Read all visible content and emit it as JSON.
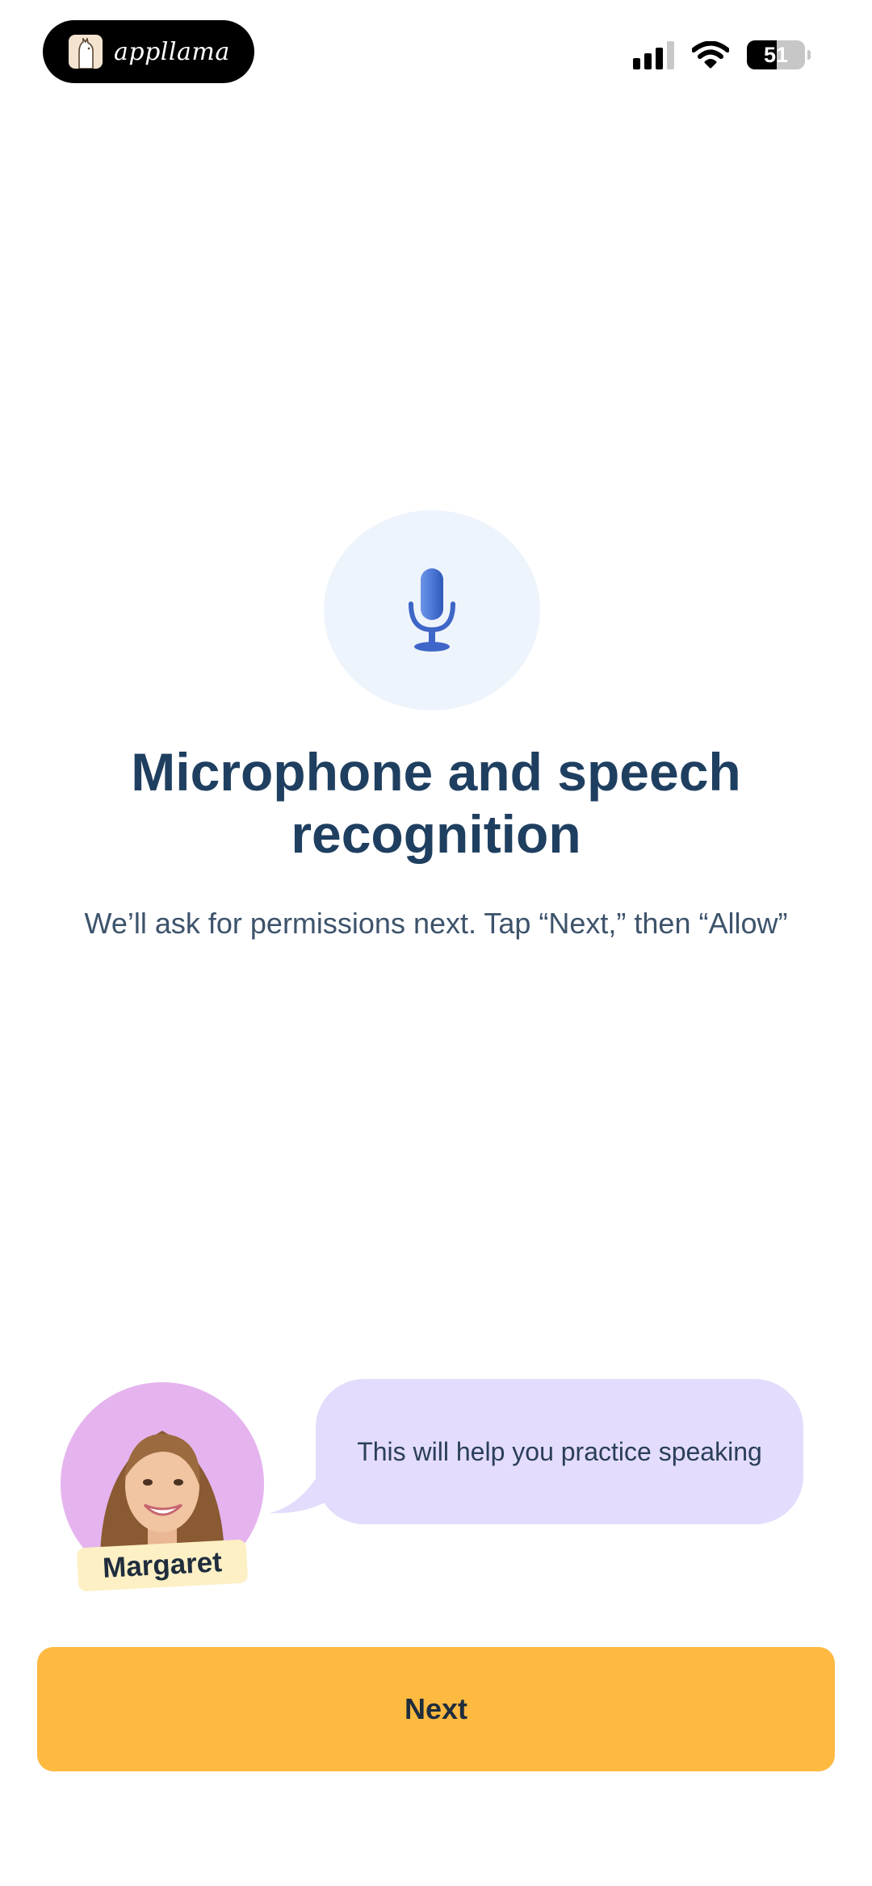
{
  "status_bar": {
    "app_pill_text": "appllama",
    "battery_level": "51",
    "battery_fraction": 0.51
  },
  "main": {
    "icon": "microphone-icon",
    "title": "Microphone and speech recognition",
    "subtitle": "We’ll ask for permissions next. Tap “Next,” then “Allow”"
  },
  "tutor": {
    "name": "Margaret",
    "message": "This will help you practice speaking"
  },
  "button": {
    "label": "Next"
  },
  "colors": {
    "title": "#1f3f60",
    "bubble": "#e3dcfc",
    "button": "#fdb940",
    "mic_circle": "#eef4fb",
    "avatar_bg": "#e5b4ee",
    "name_tag": "#fdf0c5"
  }
}
